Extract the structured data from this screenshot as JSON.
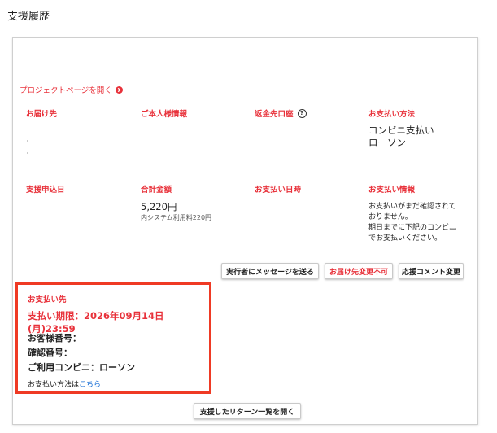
{
  "page": {
    "title": "支援履歴"
  },
  "project_link": {
    "label": "プロジェクトページを開く"
  },
  "sections": {
    "delivery_label": "お届け先",
    "personal_label": "ご本人様情報",
    "refund_label": "返金先口座",
    "payment_method_label": "お支払い方法",
    "payment_method_line1": "コンビニ支払い",
    "payment_method_line2": "ローソン",
    "apply_date_label": "支援申込日",
    "total_label": "合計金額",
    "total_value": "5,220円",
    "total_note": "内システム利用料220円",
    "pay_datetime_label": "お支払い日時",
    "pay_info_label": "お支払い情報",
    "pay_info_line1": "お支払いがまだ確認されて",
    "pay_info_line2": "おりません。",
    "pay_info_line3": "期日までに下記のコンビニ",
    "pay_info_line4": "でお支払いください。"
  },
  "buttons": {
    "message": "実行者にメッセージを送る",
    "address_change": "お届け先変更不可",
    "comment_change": "応援コメント変更",
    "returns_list": "支援したリターン一覧を開く"
  },
  "payment_box": {
    "title": "お支払い先",
    "deadline": "支払い期限：2026年09月14日(月)23:59",
    "customer_number": "お客様番号：",
    "confirmation_number": "確認番号：",
    "store": "ご利用コンビニ：ローソン",
    "method_prefix": "お支払い方法は",
    "method_link": "こちら"
  },
  "colors": {
    "accent": "#e8313a",
    "highlight_border": "#ef3a24",
    "link": "#1a6fd6"
  }
}
